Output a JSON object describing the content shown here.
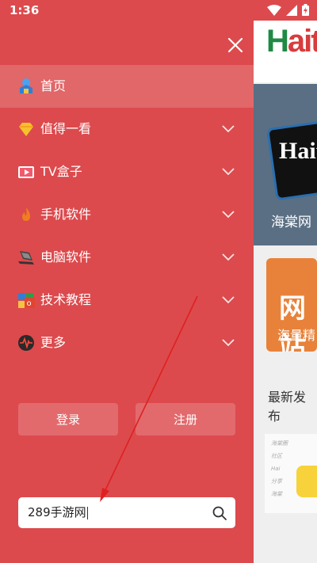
{
  "status_bar": {
    "time": "1:36"
  },
  "drawer": {
    "menu": [
      {
        "label": "首页",
        "icon": "home-icon",
        "active": true
      },
      {
        "label": "值得一看",
        "icon": "diamond-icon"
      },
      {
        "label": "TV盒子",
        "icon": "tv-play-icon"
      },
      {
        "label": "手机软件",
        "icon": "flame-icon"
      },
      {
        "label": "电脑软件",
        "icon": "laptop-icon"
      },
      {
        "label": "技术教程",
        "icon": "office-icon"
      },
      {
        "label": "更多",
        "icon": "pulse-icon"
      }
    ],
    "login_label": "登录",
    "register_label": "注册",
    "search_value": "289手游网"
  },
  "background": {
    "logo_h": "H",
    "logo_rest": "ait",
    "card1_overlay": "Hait",
    "card1_caption": "海棠网",
    "card2_big": "网站",
    "card2_caption": "海量精",
    "section_title": "最新发布"
  },
  "colors": {
    "drawer_bg": "#dc4a4d",
    "arrow": "#e02020"
  }
}
